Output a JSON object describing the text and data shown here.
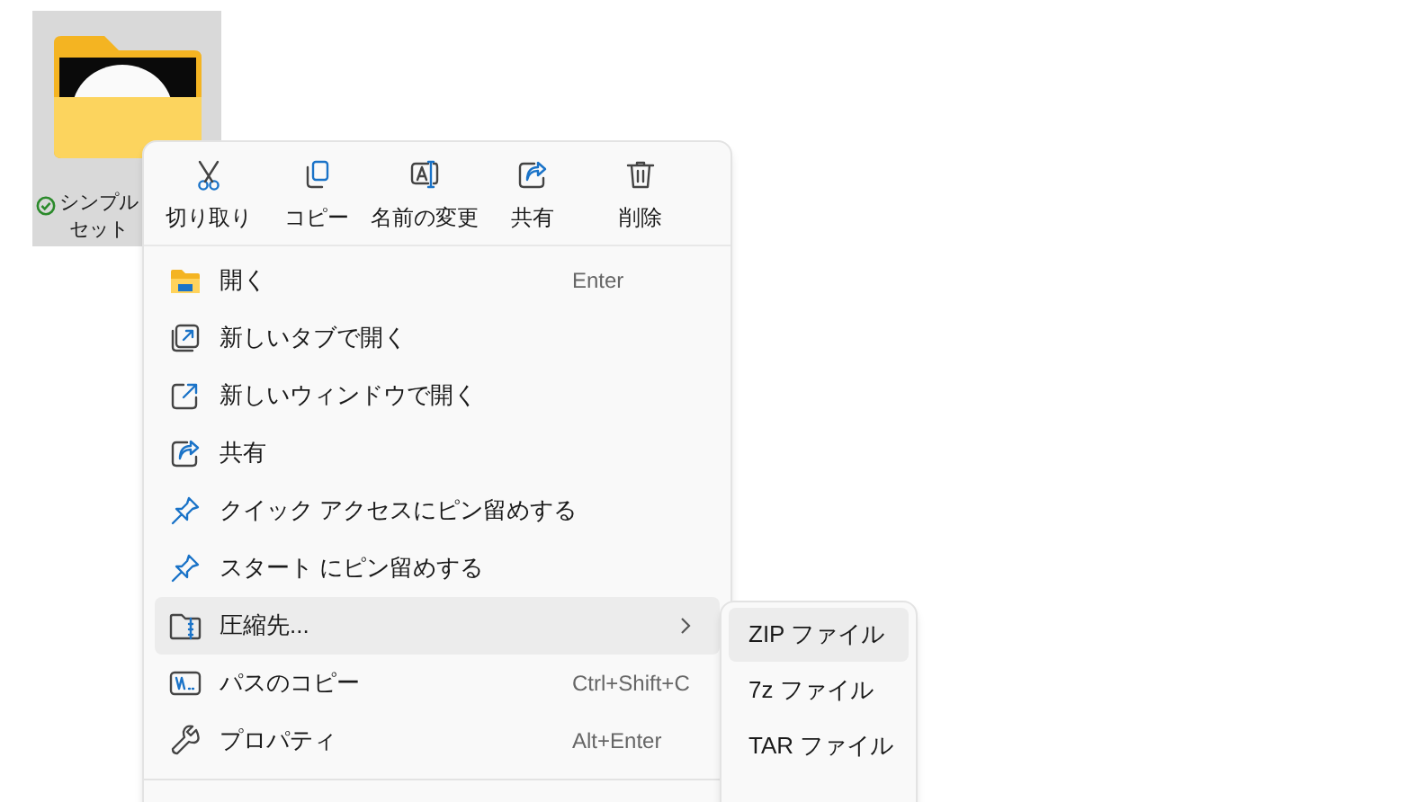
{
  "desktop_item": {
    "label_lines": [
      "シンプル",
      "セット"
    ],
    "selected": true
  },
  "context_menu": {
    "actions": [
      {
        "kind": "cut",
        "label": "切り取り"
      },
      {
        "kind": "copy",
        "label": "コピー"
      },
      {
        "kind": "rename",
        "label": "名前の変更"
      },
      {
        "kind": "share",
        "label": "共有"
      },
      {
        "kind": "delete",
        "label": "削除"
      }
    ],
    "items": [
      {
        "kind": "open",
        "label": "開く",
        "shortcut": "Enter",
        "selected": false
      },
      {
        "kind": "new-tab",
        "label": "新しいタブで開く",
        "selected": false
      },
      {
        "kind": "new-window",
        "label": "新しいウィンドウで開く",
        "selected": false
      },
      {
        "kind": "share",
        "label": "共有",
        "selected": false
      },
      {
        "kind": "pin",
        "label": "クイック アクセスにピン留めする",
        "selected": false
      },
      {
        "kind": "pin",
        "label": "スタート にピン留めする",
        "selected": false
      },
      {
        "kind": "compress",
        "label": "圧縮先...",
        "has_submenu": true,
        "selected": true
      },
      {
        "kind": "copy-path",
        "label": "パスのコピー",
        "shortcut": "Ctrl+Shift+C",
        "selected": false
      },
      {
        "kind": "properties",
        "label": "プロパティ",
        "shortcut": "Alt+Enter",
        "selected": false
      }
    ]
  },
  "submenu": {
    "items": [
      {
        "label": "ZIP ファイル",
        "selected": true
      },
      {
        "label": "7z ファイル",
        "selected": false
      },
      {
        "label": "TAR ファイル",
        "selected": false
      }
    ]
  }
}
